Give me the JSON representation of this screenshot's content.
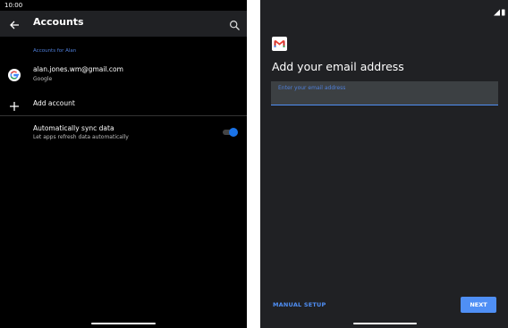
{
  "status_bar": {
    "time": "10:00"
  },
  "left_panel": {
    "appbar": {
      "title": "Accounts",
      "back_icon": "arrow-back-icon",
      "search_icon": "search-icon"
    },
    "section_header": "Accounts for Alan",
    "account": {
      "email": "alan.jones.wm@gmail.com",
      "type": "Google",
      "icon": "google-icon"
    },
    "add_account": {
      "label": "Add account",
      "icon": "plus-icon"
    },
    "sync": {
      "title": "Automatically sync data",
      "subtitle": "Let apps refresh data automatically",
      "enabled": true
    }
  },
  "right_panel": {
    "logo": "gmail-icon",
    "heading": "Add your email address",
    "email_input": {
      "placeholder": "Enter your email address",
      "value": ""
    },
    "manual_setup_label": "MANUAL SETUP",
    "next_label": "NEXT"
  },
  "colors": {
    "accent": "#4f8ff5",
    "toggle_on": "#1a73e8",
    "panel_dark": "#202124"
  }
}
